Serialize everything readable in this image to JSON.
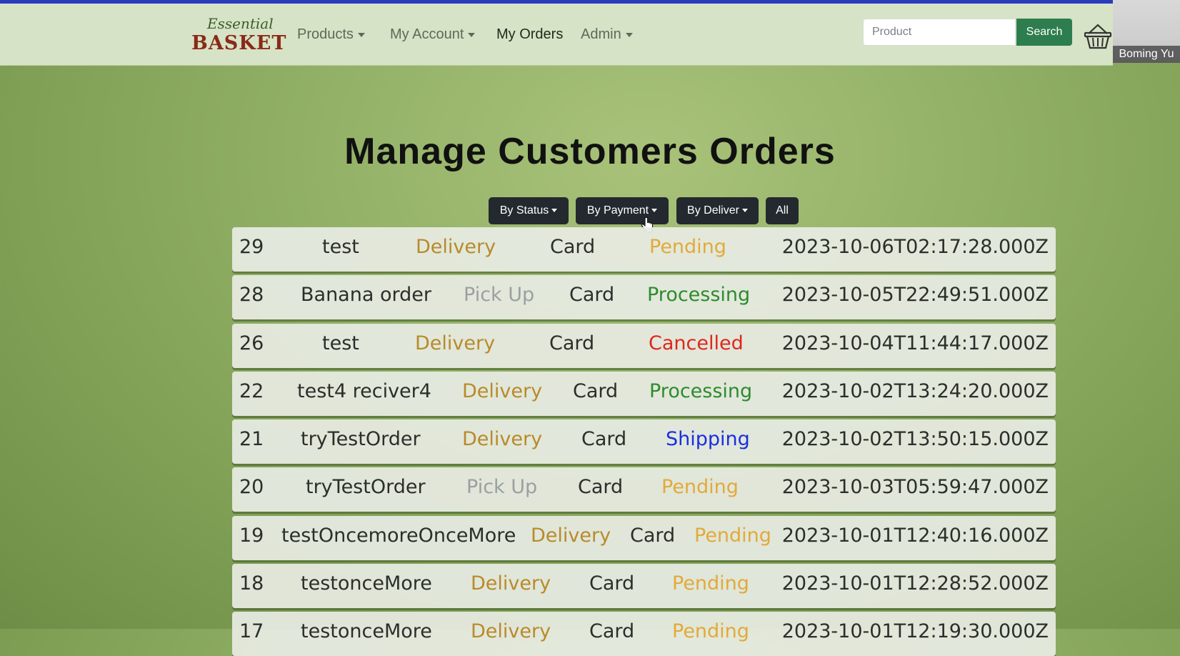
{
  "navbar": {
    "brand_script": "Essential",
    "brand_word": "BASKET",
    "items": [
      {
        "label": "Products",
        "dropdown": true
      },
      {
        "label": "My Account",
        "dropdown": true
      },
      {
        "label": "My Orders",
        "dropdown": false,
        "active": true
      },
      {
        "label": "Admin",
        "dropdown": true
      }
    ],
    "search": {
      "placeholder": "Product",
      "value": "",
      "button_label": "Search"
    },
    "cart_icon": "basket-icon"
  },
  "video_tile": {
    "name": "Boming Yu"
  },
  "page": {
    "title": "Manage Customers Orders"
  },
  "filters": [
    {
      "label": "By Status",
      "dropdown": true
    },
    {
      "label": "By Payment",
      "dropdown": true
    },
    {
      "label": "By Deliver",
      "dropdown": true
    },
    {
      "label": "All",
      "dropdown": false
    }
  ],
  "status_colors": {
    "Pending": "#e2aa3a",
    "Processing": "#2e8b2e",
    "Cancelled": "#e0271b",
    "Shipping": "#1a2ee0"
  },
  "orders": [
    {
      "id": "29",
      "name": "test",
      "delivery": "Delivery",
      "payment": "Card",
      "status": "Pending",
      "date": "2023-10-06T02:17:28.000Z"
    },
    {
      "id": "28",
      "name": "Banana order",
      "delivery": "Pick Up",
      "payment": "Card",
      "status": "Processing",
      "date": "2023-10-05T22:49:51.000Z"
    },
    {
      "id": "26",
      "name": "test",
      "delivery": "Delivery",
      "payment": "Card",
      "status": "Cancelled",
      "date": "2023-10-04T11:44:17.000Z"
    },
    {
      "id": "22",
      "name": "test4 reciver4",
      "delivery": "Delivery",
      "payment": "Card",
      "status": "Processing",
      "date": "2023-10-02T13:24:20.000Z"
    },
    {
      "id": "21",
      "name": "tryTestOrder",
      "delivery": "Delivery",
      "payment": "Card",
      "status": "Shipping",
      "date": "2023-10-02T13:50:15.000Z"
    },
    {
      "id": "20",
      "name": "tryTestOrder",
      "delivery": "Pick Up",
      "payment": "Card",
      "status": "Pending",
      "date": "2023-10-03T05:59:47.000Z"
    },
    {
      "id": "19",
      "name": "testOncemoreOnceMore",
      "delivery": "Delivery",
      "payment": "Card",
      "status": "Pending",
      "date": "2023-10-01T12:40:16.000Z"
    },
    {
      "id": "18",
      "name": "testonceMore",
      "delivery": "Delivery",
      "payment": "Card",
      "status": "Pending",
      "date": "2023-10-01T12:28:52.000Z"
    },
    {
      "id": "17",
      "name": "testonceMore",
      "delivery": "Delivery",
      "payment": "Card",
      "status": "Pending",
      "date": "2023-10-01T12:19:30.000Z"
    }
  ]
}
